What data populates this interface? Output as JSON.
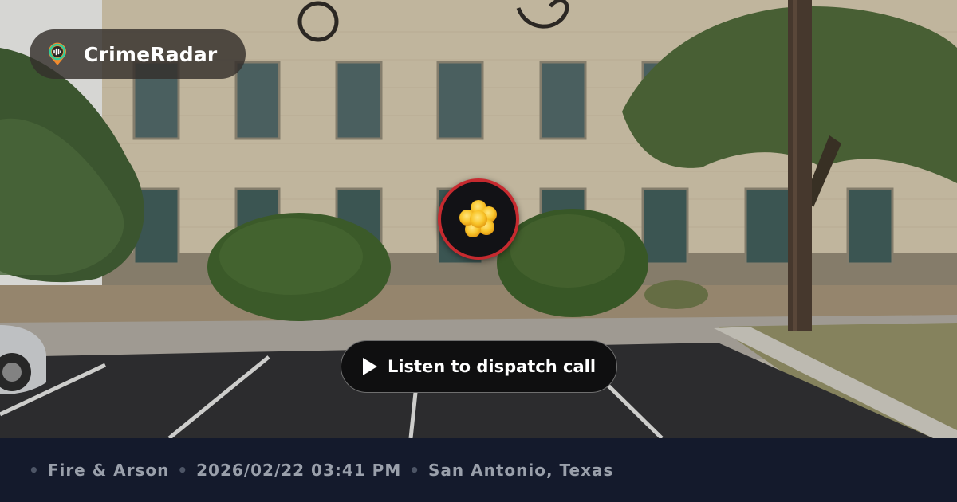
{
  "brand": {
    "name": "CrimeRadar",
    "logo_icon": "radar-pin-icon",
    "colors": {
      "pin": "#f28a2e",
      "ring": "#2ecc9a",
      "bars": "#ffffff"
    }
  },
  "incident": {
    "marker_icon": "fire-arson-icon",
    "marker_ring_color": "#c62a2f",
    "category": "Fire & Arson",
    "datetime": "2026/02/22 03:41 PM",
    "location": "San Antonio, Texas"
  },
  "actions": {
    "listen_label": "Listen to dispatch call",
    "listen_icon": "play-icon"
  },
  "footer": {
    "separator": "•",
    "background": "#141a2c",
    "text_color": "#9aa0ab"
  },
  "background": {
    "description_icon": "street-view-photo"
  }
}
